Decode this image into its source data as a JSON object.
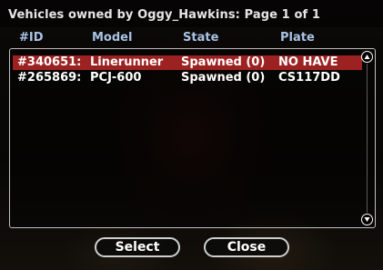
{
  "dialog": {
    "title": "Vehicles owned by Oggy_Hawkins: Page 1 of 1",
    "columns": {
      "id": "#ID",
      "model": "Model",
      "state": "State",
      "plate": "Plate"
    },
    "rows": [
      {
        "id": "#340651:",
        "model": "Linerunner",
        "state": "Spawned (0)",
        "plate": "NO HAVE",
        "selected": true
      },
      {
        "id": "#265869:",
        "model": "PCJ-600",
        "state": "Spawned (0)",
        "plate": "CS117DD",
        "selected": false
      }
    ],
    "buttons": {
      "select": "Select",
      "close": "Close"
    },
    "colors": {
      "header": "#a9c3e6",
      "selected_row": "#9c2222",
      "text": "#ffffff"
    },
    "icons": {
      "scroll_up": "scroll-up-arrow-icon",
      "scroll_down": "scroll-down-arrow-icon"
    }
  }
}
